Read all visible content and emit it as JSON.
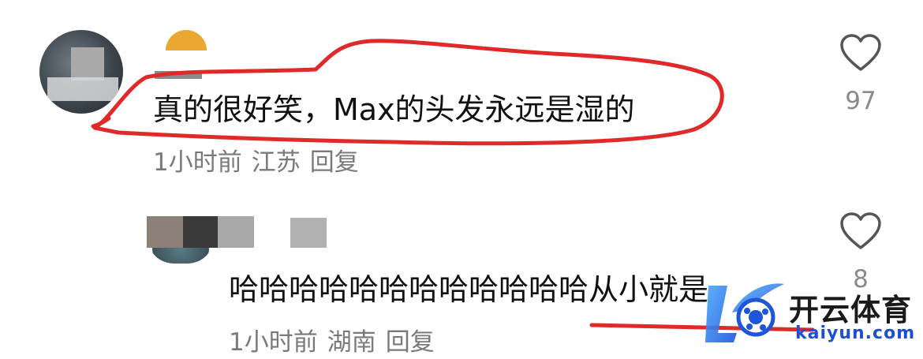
{
  "comments": [
    {
      "text": "真的很好笑，Max的头发永远是湿的",
      "time": "1小时前",
      "location": "江苏",
      "reply_label": "回复",
      "likes": "97"
    },
    {
      "text": "哈哈哈哈哈哈哈哈哈哈哈哈从小就是",
      "time": "1小时前",
      "location": "湖南",
      "reply_label": "回复",
      "likes": "8"
    }
  ],
  "watermark": {
    "brand": "开云体育",
    "url": "kaiyun.com"
  },
  "colors": {
    "annotation_circle": "#e02a2a",
    "meta_text": "#7a7a7a",
    "watermark_blue": "#1f6fe0"
  }
}
